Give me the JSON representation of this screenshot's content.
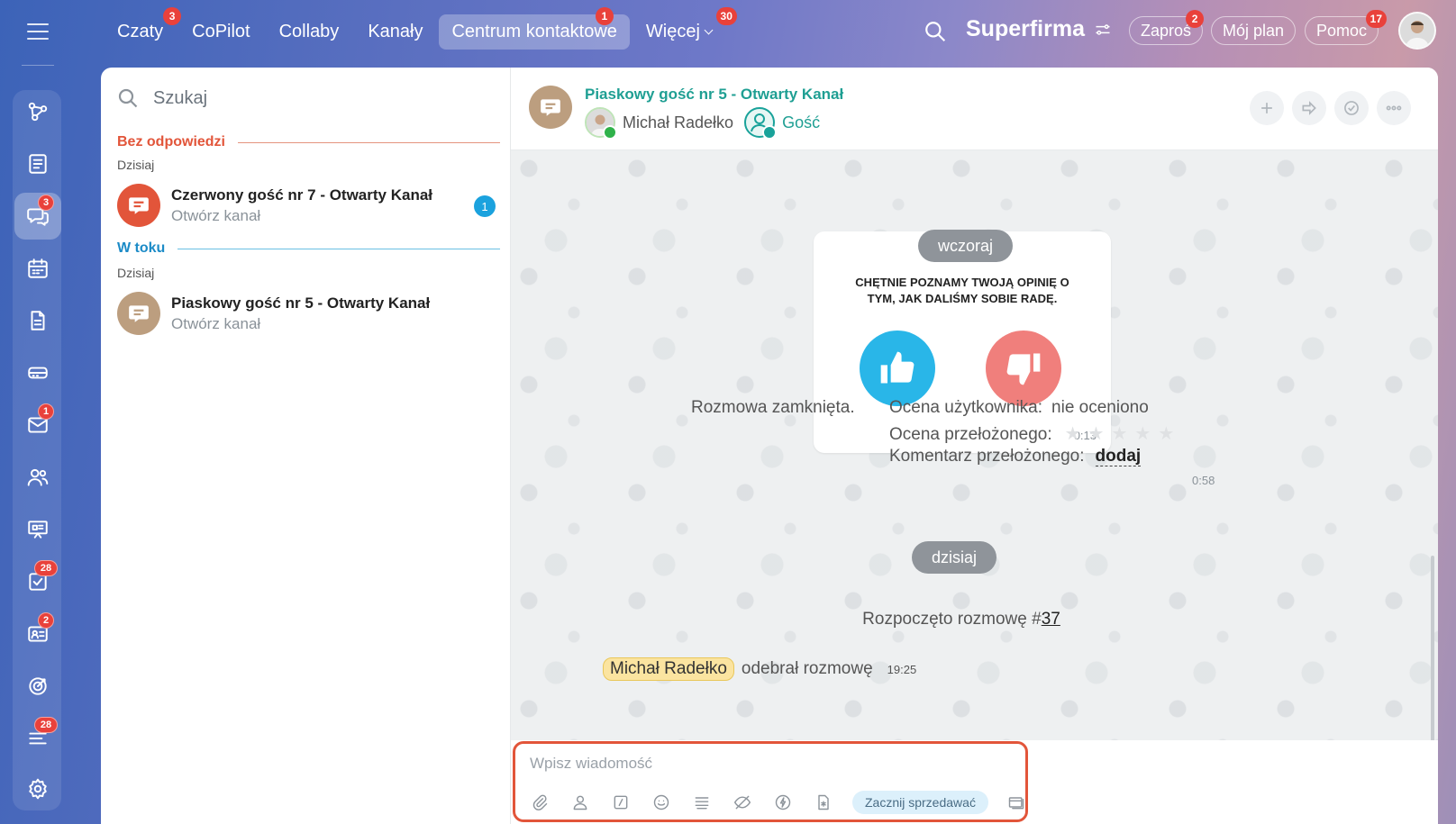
{
  "topnav": {
    "items": [
      {
        "label": "Czaty",
        "badge": "3"
      },
      {
        "label": "CoPilot",
        "badge": ""
      },
      {
        "label": "Collaby",
        "badge": ""
      },
      {
        "label": "Kanały",
        "badge": ""
      },
      {
        "label": "Centrum kontaktowe",
        "badge": "1",
        "active": true
      },
      {
        "label": "Więcej",
        "badge": "30"
      }
    ],
    "brand": "Superfirma",
    "invite": {
      "label": "Zaproś",
      "badge": "2"
    },
    "plan": {
      "label": "Mój plan"
    },
    "help": {
      "label": "Pomoc",
      "badge": "17"
    }
  },
  "rail": {
    "badges": {
      "chats": "3",
      "mail": "1",
      "tasks": "28",
      "crm": "2",
      "feed": "28"
    }
  },
  "list": {
    "search_placeholder": "Szukaj",
    "sections": [
      {
        "title": "Bez odpowiedzi",
        "day": "Dzisiaj",
        "items": [
          {
            "title": "Czerwony gość nr 7 - Otwarty Kanał",
            "subtitle": "Otwórz kanał",
            "unread": "1"
          }
        ]
      },
      {
        "title": "W toku",
        "day": "Dzisiaj",
        "items": [
          {
            "title": "Piaskowy gość nr 5 - Otwarty Kanał",
            "subtitle": "Otwórz kanał"
          }
        ]
      }
    ]
  },
  "chat": {
    "title": "Piaskowy gość nr 5 - Otwarty Kanał",
    "members": [
      {
        "name": "Michał Radełko"
      },
      {
        "name": "Gość"
      }
    ],
    "messages": {
      "date_yesterday": "wczoraj",
      "rating_question": "CHĘTNIE POZNAMY TWOJĄ OPINIĘ O TYM, JAK DALIŚMY SOBIE RADĘ.",
      "rating_time": "0:13",
      "closed_label": "Rozmowa zamknięta.",
      "user_rating_label": "Ocena użytkownika:",
      "user_rating_value": "nie oceniono",
      "supervisor_rating_label": "Ocena przełożonego:",
      "supervisor_rating_stars": 0,
      "supervisor_comment_label": "Komentarz przełożonego:",
      "supervisor_comment_link": "dodaj",
      "closed_time": "0:58",
      "date_today": "dzisiaj",
      "started_text": "Rozpoczęto rozmowę #",
      "started_number": "37",
      "accepted_name": "Michał Radełko",
      "accepted_text": "odebrał rozmowę",
      "accepted_time": "19:25"
    },
    "input": {
      "placeholder": "Wpisz wiadomość",
      "sell_button": "Zacznij sprzedawać"
    }
  },
  "colors": {
    "accent_red": "#e2553a",
    "accent_blue": "#1c8bc7",
    "thumb_up": "#29b6e8",
    "thumb_down": "#f07f7c",
    "chat_title": "#1f9f93"
  }
}
